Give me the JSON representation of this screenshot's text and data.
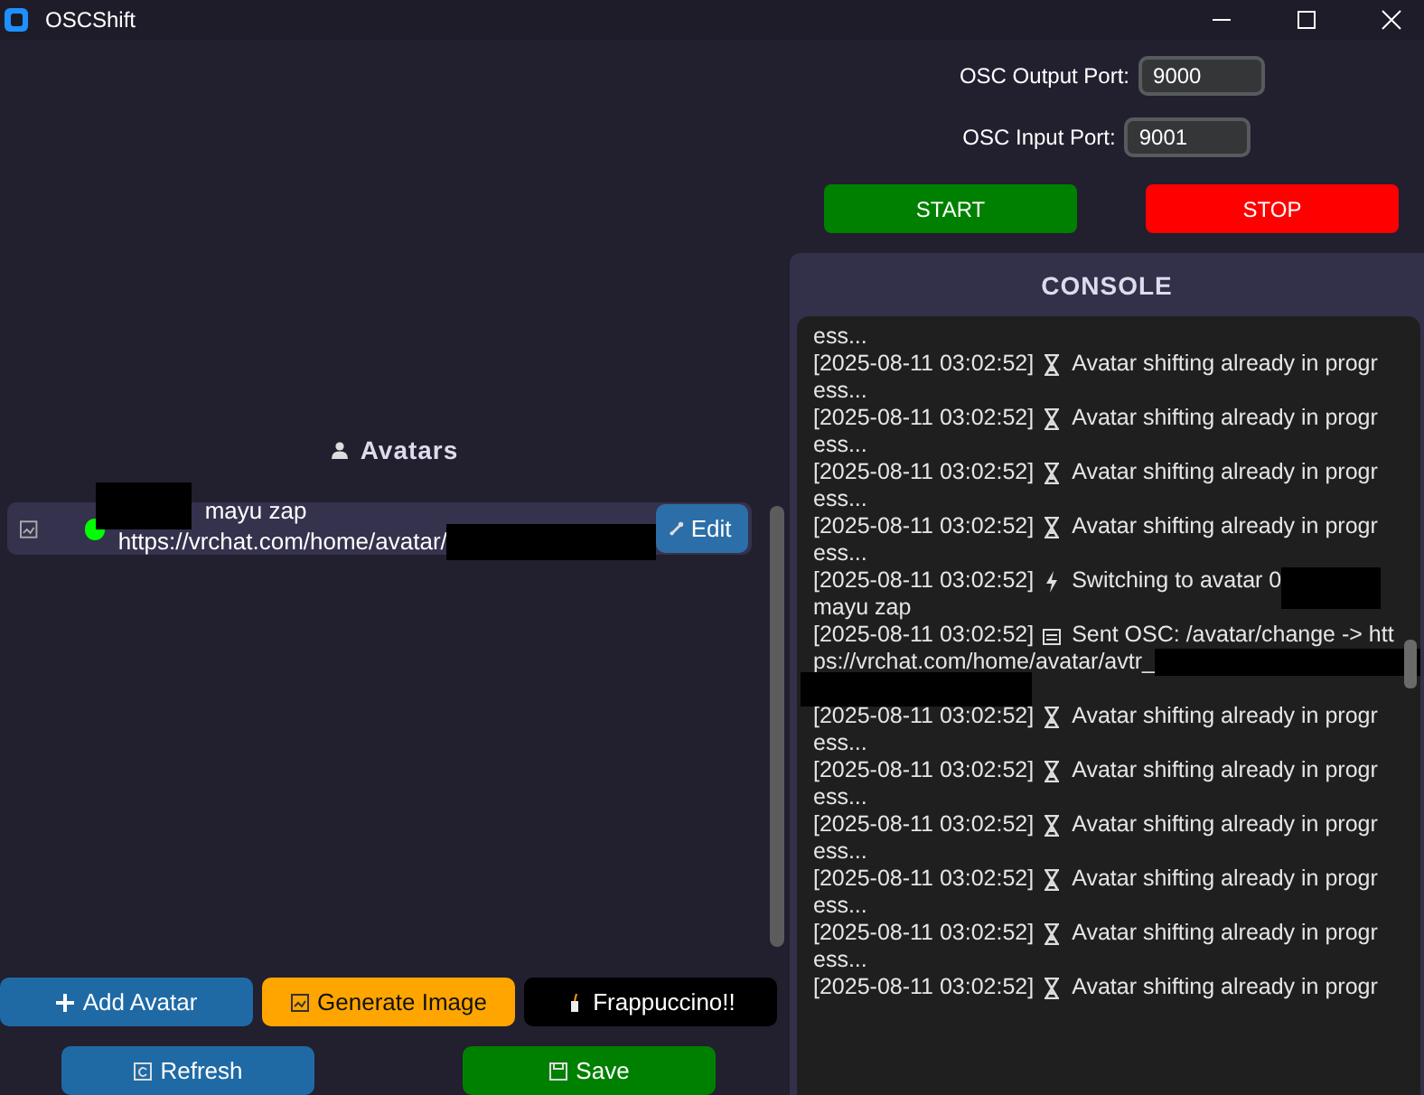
{
  "window": {
    "title": "OSCShift"
  },
  "ports": [
    {
      "label": "OSC Output Port:",
      "value": "9000"
    },
    {
      "label": "OSC Input Port:",
      "value": "9001"
    }
  ],
  "controls": [
    {
      "label": "START",
      "kind": "start"
    },
    {
      "label": "STOP",
      "kind": "stop"
    }
  ],
  "avatars": {
    "title": "Avatars",
    "items": [
      {
        "name": "mayu zap",
        "url": "https://vrchat.com/home/avatar/",
        "active": true,
        "edit": "Edit"
      }
    ]
  },
  "actions": [
    {
      "label": "Add Avatar",
      "kind": "add"
    },
    {
      "label": "Generate Image",
      "kind": "generate"
    },
    {
      "label": "Frappuccino!!",
      "kind": "coffee"
    }
  ],
  "footer": [
    {
      "label": "Refresh",
      "kind": "refresh"
    },
    {
      "label": "Save",
      "kind": "save"
    }
  ],
  "console": {
    "title": "CONSOLE",
    "entries": [
      {
        "kind": "continuation",
        "text": "ess..."
      },
      {
        "kind": "waiting",
        "time": "[2025-08-11 03:02:52]",
        "text": "Avatar shifting already in progr",
        "continued": "ess..."
      },
      {
        "kind": "waiting",
        "time": "[2025-08-11 03:02:52]",
        "text": "Avatar shifting already in progr",
        "continued": "ess..."
      },
      {
        "kind": "waiting",
        "time": "[2025-08-11 03:02:52]",
        "text": "Avatar shifting already in progr",
        "continued": "ess..."
      },
      {
        "kind": "waiting",
        "time": "[2025-08-11 03:02:52]",
        "text": "Avatar shifting already in progr",
        "continued": "ess..."
      },
      {
        "kind": "switch",
        "time": "[2025-08-11 03:02:52]",
        "text": "Switching to avatar 0",
        "continued": "mayu zap"
      },
      {
        "kind": "sent",
        "time": "[2025-08-11 03:02:52]",
        "text": "Sent OSC: /avatar/change -> htt",
        "continued": "ps://vrchat.com/home/avatar/avtr_"
      },
      {
        "kind": "waiting",
        "time": "[2025-08-11 03:02:52]",
        "text": "Avatar shifting already in progr",
        "continued": "ess..."
      },
      {
        "kind": "waiting",
        "time": "[2025-08-11 03:02:52]",
        "text": "Avatar shifting already in progr",
        "continued": "ess..."
      },
      {
        "kind": "waiting",
        "time": "[2025-08-11 03:02:52]",
        "text": "Avatar shifting already in progr",
        "continued": "ess..."
      },
      {
        "kind": "waiting",
        "time": "[2025-08-11 03:02:52]",
        "text": "Avatar shifting already in progr",
        "continued": "ess..."
      },
      {
        "kind": "waiting",
        "time": "[2025-08-11 03:02:52]",
        "text": "Avatar shifting already in progr",
        "continued": "ess..."
      },
      {
        "kind": "waiting",
        "time": "[2025-08-11 03:02:52]",
        "text": "Avatar shifting already in progr"
      }
    ]
  }
}
